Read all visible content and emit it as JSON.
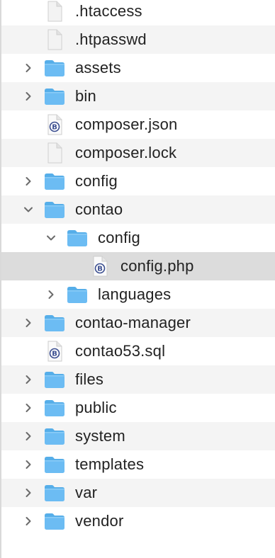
{
  "file_tree": {
    "items": [
      {
        "label": ".htaccess",
        "type": "file",
        "icon": "blank-file-icon",
        "depth": 0,
        "toggle": "none"
      },
      {
        "label": ".htpasswd",
        "type": "file",
        "icon": "blank-file-icon",
        "depth": 0,
        "toggle": "none"
      },
      {
        "label": "assets",
        "type": "folder",
        "icon": "folder-icon",
        "depth": 0,
        "toggle": "collapsed"
      },
      {
        "label": "bin",
        "type": "folder",
        "icon": "folder-icon",
        "depth": 0,
        "toggle": "collapsed"
      },
      {
        "label": "composer.json",
        "type": "file",
        "icon": "bbedit-document-icon",
        "depth": 0,
        "toggle": "none"
      },
      {
        "label": "composer.lock",
        "type": "file",
        "icon": "blank-file-icon",
        "depth": 0,
        "toggle": "none"
      },
      {
        "label": "config",
        "type": "folder",
        "icon": "folder-icon",
        "depth": 0,
        "toggle": "collapsed"
      },
      {
        "label": "contao",
        "type": "folder",
        "icon": "folder-icon",
        "depth": 0,
        "toggle": "expanded"
      },
      {
        "label": "config",
        "type": "folder",
        "icon": "folder-icon",
        "depth": 1,
        "toggle": "expanded"
      },
      {
        "label": "config.php",
        "type": "file",
        "icon": "bbedit-document-icon",
        "depth": 2,
        "toggle": "none",
        "selected": true
      },
      {
        "label": "languages",
        "type": "folder",
        "icon": "folder-icon",
        "depth": 1,
        "toggle": "collapsed"
      },
      {
        "label": "contao-manager",
        "type": "folder",
        "icon": "folder-icon",
        "depth": 0,
        "toggle": "collapsed"
      },
      {
        "label": "contao53.sql",
        "type": "file",
        "icon": "bbedit-document-icon",
        "depth": 0,
        "toggle": "none"
      },
      {
        "label": "files",
        "type": "folder",
        "icon": "folder-icon",
        "depth": 0,
        "toggle": "collapsed"
      },
      {
        "label": "public",
        "type": "folder",
        "icon": "folder-icon",
        "depth": 0,
        "toggle": "collapsed"
      },
      {
        "label": "system",
        "type": "folder",
        "icon": "folder-icon",
        "depth": 0,
        "toggle": "collapsed"
      },
      {
        "label": "templates",
        "type": "folder",
        "icon": "folder-icon",
        "depth": 0,
        "toggle": "collapsed"
      },
      {
        "label": "var",
        "type": "folder",
        "icon": "folder-icon",
        "depth": 0,
        "toggle": "collapsed"
      },
      {
        "label": "vendor",
        "type": "folder",
        "icon": "folder-icon",
        "depth": 0,
        "toggle": "collapsed"
      }
    ]
  },
  "colors": {
    "folder": "#6cbcf3",
    "folder_tab": "#56aee9",
    "row_alt": "#f4f4f4",
    "row_selected": "#dcdcdc",
    "text": "#222222",
    "chevron": "#6b6b6b"
  }
}
